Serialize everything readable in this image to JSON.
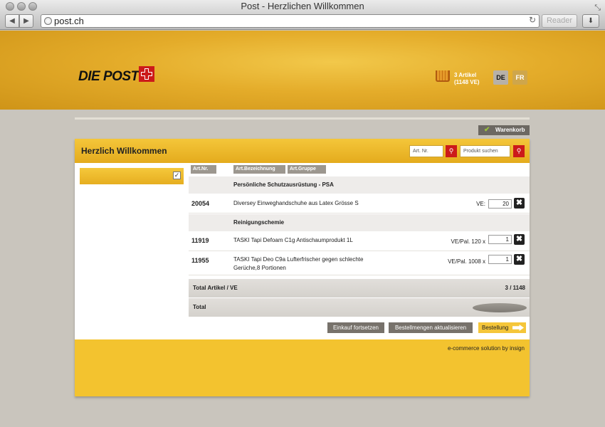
{
  "browser": {
    "window_title": "Post - Herzlichen Willkommen",
    "url": "post.ch",
    "reader_label": "Reader"
  },
  "header": {
    "logo_text": "DIE POST",
    "cart_count": "3 Artikel",
    "cart_units": "(1148 VE)",
    "lang_de": "DE",
    "lang_fr": "FR"
  },
  "warenkorb_label": "Warenkorb",
  "panel": {
    "title": "Herzlich Willkommen",
    "search_artnr_placeholder": "Art. Nr.",
    "search_product_placeholder": "Produkt suchen"
  },
  "table": {
    "columns": [
      "Art.Nr.",
      "Art.Bezeichnung",
      "Art.Gruppe"
    ],
    "groups": [
      {
        "name": "Persönliche Schutzausrüstung - PSA",
        "items": [
          {
            "art_nr": "20054",
            "description": "Diversey Einweghandschuhe aus Latex Grösse S",
            "ve_label": "VE:",
            "qty": "20"
          }
        ]
      },
      {
        "name": "Reinigungschemie",
        "items": [
          {
            "art_nr": "11919",
            "description": "TASKI Tapi Defoam C1g Antischaumprodukt 1L",
            "ve_label": "VE/Pal. 120 x",
            "qty": "1"
          },
          {
            "art_nr": "11955",
            "description": "TASKI Tapi Deo C9a Lufterfrischer gegen schlechte Gerüche,8 Portionen",
            "ve_label": "VE/Pal. 1008 x",
            "qty": "1"
          }
        ]
      }
    ],
    "total_artikel_label": "Total Artikel / VE",
    "total_artikel_value": "3 / 1148",
    "total_label": "Total"
  },
  "actions": {
    "einkauf": "Einkauf fortsetzen",
    "aktualisieren": "Bestellmengen aktualisieren",
    "bestellung": "Bestellung"
  },
  "footer": {
    "text": "e-commerce solution by insign"
  },
  "colors": {
    "brand_yellow": "#f3c32f",
    "brand_red": "#cc1a1a",
    "button_gray": "#77726b"
  }
}
